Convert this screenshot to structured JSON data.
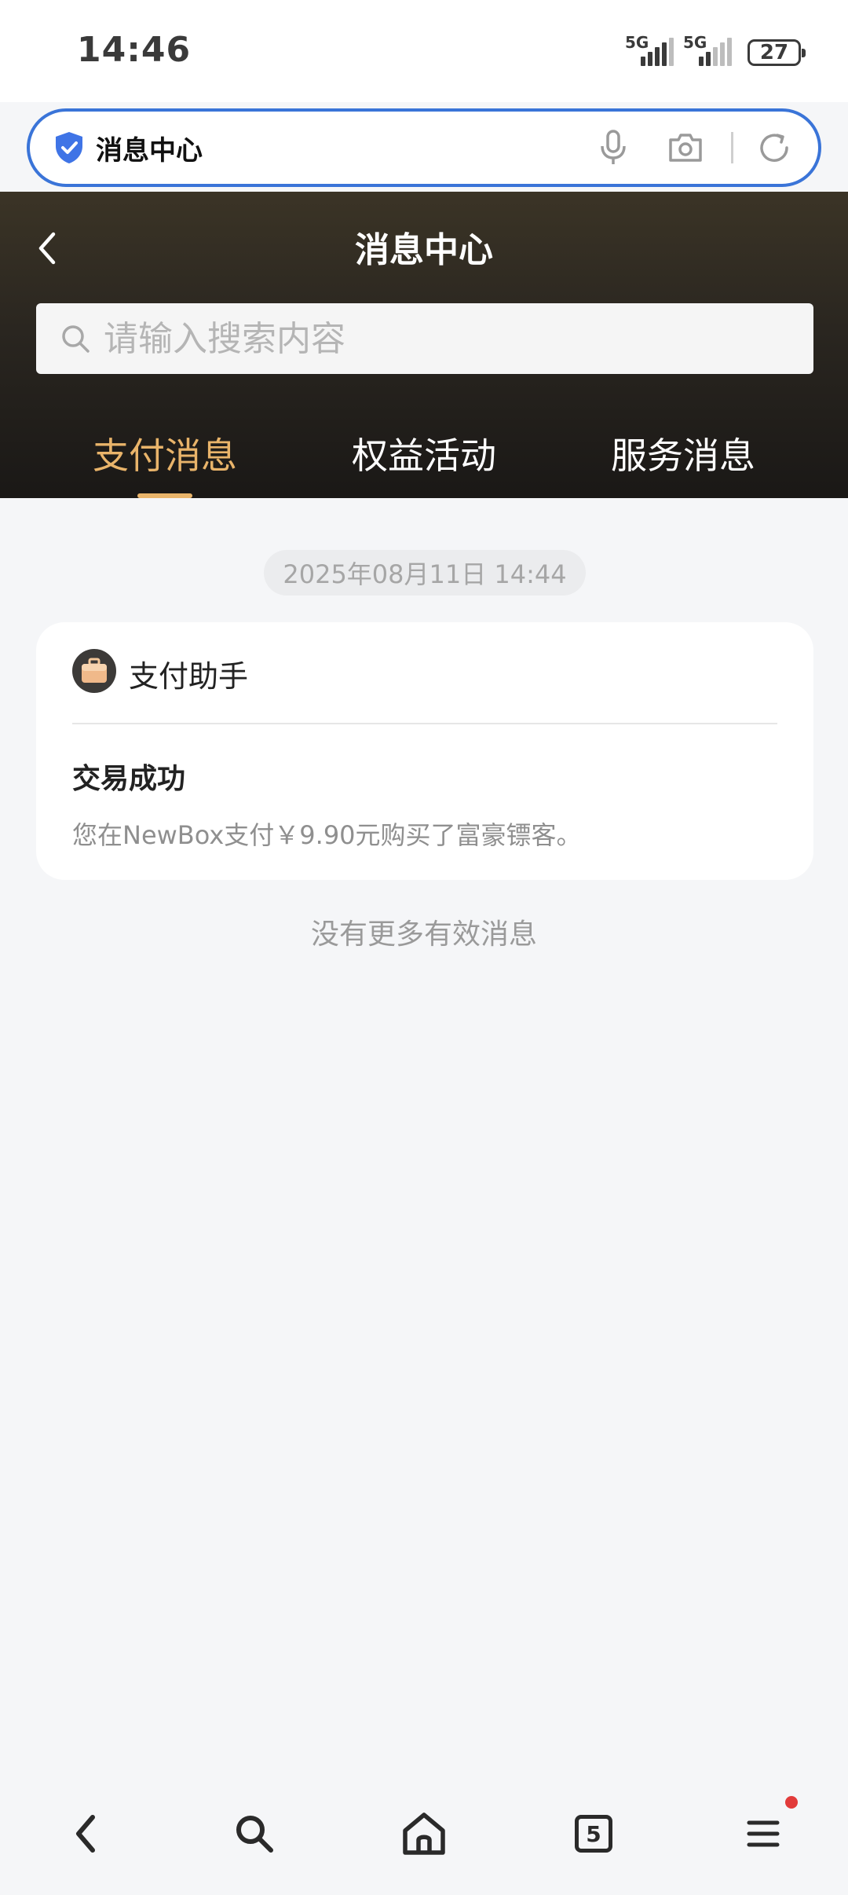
{
  "status_bar": {
    "time": "14:46",
    "sim1_label": "5G",
    "sim2_label": "5G",
    "battery": "27"
  },
  "address_bar": {
    "title": "消息中心",
    "icons": [
      "shield-check-icon",
      "microphone-icon",
      "camera-icon",
      "refresh-icon"
    ]
  },
  "header": {
    "title": "消息中心",
    "search_placeholder": "请输入搜索内容"
  },
  "tabs": [
    {
      "label": "支付消息",
      "active": true
    },
    {
      "label": "权益活动",
      "active": false
    },
    {
      "label": "服务消息",
      "active": false
    }
  ],
  "messages": [
    {
      "date": "2025年08月11日 14:44",
      "sender": "支付助手",
      "title": "交易成功",
      "description": "您在NewBox支付￥9.90元购买了富豪镖客。"
    }
  ],
  "footer_text": "没有更多有效消息",
  "bottom_nav": {
    "tab_count": "5",
    "items": [
      "back-icon",
      "search-icon",
      "home-icon",
      "tabs-icon",
      "menu-icon"
    ]
  },
  "colors": {
    "accent": "#e9b46a",
    "address_border": "#3a74d8",
    "shield": "#3f74e6",
    "notification_dot": "#e23b3b"
  }
}
